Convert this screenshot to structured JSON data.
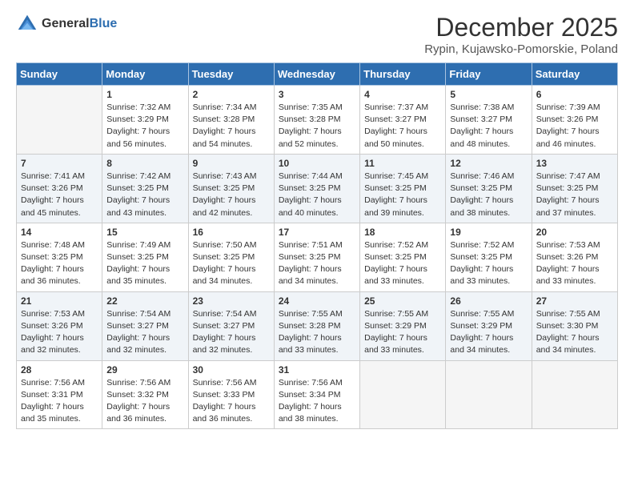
{
  "header": {
    "logo_general": "General",
    "logo_blue": "Blue",
    "month": "December 2025",
    "location": "Rypin, Kujawsko-Pomorskie, Poland"
  },
  "weekdays": [
    "Sunday",
    "Monday",
    "Tuesday",
    "Wednesday",
    "Thursday",
    "Friday",
    "Saturday"
  ],
  "weeks": [
    [
      {
        "day": "",
        "content": ""
      },
      {
        "day": "1",
        "content": "Sunrise: 7:32 AM\nSunset: 3:29 PM\nDaylight: 7 hours\nand 56 minutes."
      },
      {
        "day": "2",
        "content": "Sunrise: 7:34 AM\nSunset: 3:28 PM\nDaylight: 7 hours\nand 54 minutes."
      },
      {
        "day": "3",
        "content": "Sunrise: 7:35 AM\nSunset: 3:28 PM\nDaylight: 7 hours\nand 52 minutes."
      },
      {
        "day": "4",
        "content": "Sunrise: 7:37 AM\nSunset: 3:27 PM\nDaylight: 7 hours\nand 50 minutes."
      },
      {
        "day": "5",
        "content": "Sunrise: 7:38 AM\nSunset: 3:27 PM\nDaylight: 7 hours\nand 48 minutes."
      },
      {
        "day": "6",
        "content": "Sunrise: 7:39 AM\nSunset: 3:26 PM\nDaylight: 7 hours\nand 46 minutes."
      }
    ],
    [
      {
        "day": "7",
        "content": "Sunrise: 7:41 AM\nSunset: 3:26 PM\nDaylight: 7 hours\nand 45 minutes."
      },
      {
        "day": "8",
        "content": "Sunrise: 7:42 AM\nSunset: 3:25 PM\nDaylight: 7 hours\nand 43 minutes."
      },
      {
        "day": "9",
        "content": "Sunrise: 7:43 AM\nSunset: 3:25 PM\nDaylight: 7 hours\nand 42 minutes."
      },
      {
        "day": "10",
        "content": "Sunrise: 7:44 AM\nSunset: 3:25 PM\nDaylight: 7 hours\nand 40 minutes."
      },
      {
        "day": "11",
        "content": "Sunrise: 7:45 AM\nSunset: 3:25 PM\nDaylight: 7 hours\nand 39 minutes."
      },
      {
        "day": "12",
        "content": "Sunrise: 7:46 AM\nSunset: 3:25 PM\nDaylight: 7 hours\nand 38 minutes."
      },
      {
        "day": "13",
        "content": "Sunrise: 7:47 AM\nSunset: 3:25 PM\nDaylight: 7 hours\nand 37 minutes."
      }
    ],
    [
      {
        "day": "14",
        "content": "Sunrise: 7:48 AM\nSunset: 3:25 PM\nDaylight: 7 hours\nand 36 minutes."
      },
      {
        "day": "15",
        "content": "Sunrise: 7:49 AM\nSunset: 3:25 PM\nDaylight: 7 hours\nand 35 minutes."
      },
      {
        "day": "16",
        "content": "Sunrise: 7:50 AM\nSunset: 3:25 PM\nDaylight: 7 hours\nand 34 minutes."
      },
      {
        "day": "17",
        "content": "Sunrise: 7:51 AM\nSunset: 3:25 PM\nDaylight: 7 hours\nand 34 minutes."
      },
      {
        "day": "18",
        "content": "Sunrise: 7:52 AM\nSunset: 3:25 PM\nDaylight: 7 hours\nand 33 minutes."
      },
      {
        "day": "19",
        "content": "Sunrise: 7:52 AM\nSunset: 3:25 PM\nDaylight: 7 hours\nand 33 minutes."
      },
      {
        "day": "20",
        "content": "Sunrise: 7:53 AM\nSunset: 3:26 PM\nDaylight: 7 hours\nand 33 minutes."
      }
    ],
    [
      {
        "day": "21",
        "content": "Sunrise: 7:53 AM\nSunset: 3:26 PM\nDaylight: 7 hours\nand 32 minutes."
      },
      {
        "day": "22",
        "content": "Sunrise: 7:54 AM\nSunset: 3:27 PM\nDaylight: 7 hours\nand 32 minutes."
      },
      {
        "day": "23",
        "content": "Sunrise: 7:54 AM\nSunset: 3:27 PM\nDaylight: 7 hours\nand 32 minutes."
      },
      {
        "day": "24",
        "content": "Sunrise: 7:55 AM\nSunset: 3:28 PM\nDaylight: 7 hours\nand 33 minutes."
      },
      {
        "day": "25",
        "content": "Sunrise: 7:55 AM\nSunset: 3:29 PM\nDaylight: 7 hours\nand 33 minutes."
      },
      {
        "day": "26",
        "content": "Sunrise: 7:55 AM\nSunset: 3:29 PM\nDaylight: 7 hours\nand 34 minutes."
      },
      {
        "day": "27",
        "content": "Sunrise: 7:55 AM\nSunset: 3:30 PM\nDaylight: 7 hours\nand 34 minutes."
      }
    ],
    [
      {
        "day": "28",
        "content": "Sunrise: 7:56 AM\nSunset: 3:31 PM\nDaylight: 7 hours\nand 35 minutes."
      },
      {
        "day": "29",
        "content": "Sunrise: 7:56 AM\nSunset: 3:32 PM\nDaylight: 7 hours\nand 36 minutes."
      },
      {
        "day": "30",
        "content": "Sunrise: 7:56 AM\nSunset: 3:33 PM\nDaylight: 7 hours\nand 36 minutes."
      },
      {
        "day": "31",
        "content": "Sunrise: 7:56 AM\nSunset: 3:34 PM\nDaylight: 7 hours\nand 38 minutes."
      },
      {
        "day": "",
        "content": ""
      },
      {
        "day": "",
        "content": ""
      },
      {
        "day": "",
        "content": ""
      }
    ]
  ]
}
